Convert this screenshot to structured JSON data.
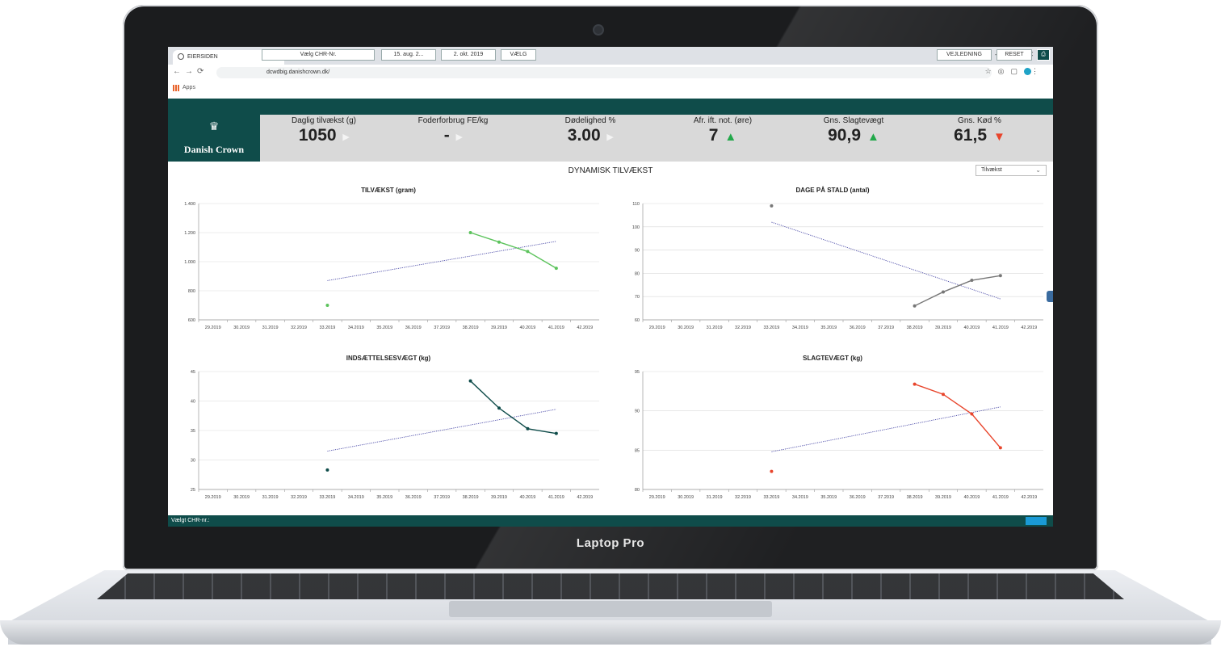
{
  "laptop": {
    "brand": "Laptop Pro"
  },
  "browser": {
    "tab_title": "EIERSIDEN",
    "tab_close": "×",
    "new_tab": "+",
    "url": "dcwdbig.danishcrown.dk/",
    "bookmarks_label": "Apps"
  },
  "app": {
    "logo_text": "Danish Crown",
    "toolbar": {
      "choose_chr": "Vælg CHR-Nr.",
      "date_from": "15. aug. 2...",
      "date_to": "2. okt. 2019",
      "select_button": "VÆLG",
      "guide_button": "VEJLEDNING",
      "reset_button": "RESET"
    },
    "kpis": [
      {
        "label": "Daglig tilvækst (g)",
        "value": "1050",
        "trend": "none"
      },
      {
        "label": "Foderforbrug FE/kg",
        "value": "-",
        "trend": "none"
      },
      {
        "label": "Dødelighed %",
        "value": "3.00",
        "trend": "none"
      },
      {
        "label": "Afr. ift. not. (øre)",
        "value": "7",
        "trend": "up"
      },
      {
        "label": "Gns. Slagtevægt",
        "value": "90,9",
        "trend": "up"
      },
      {
        "label": "Gns. Kød %",
        "value": "61,5",
        "trend": "down"
      }
    ],
    "page_title": "DYNAMISK TILVÆKST",
    "view_dropdown": "Tilvækst",
    "status_text": "Vælgt CHR-nr.:",
    "colors": {
      "brand": "#0f4c4a",
      "up": "#22a84a",
      "down": "#e8452c"
    }
  },
  "chart_data": [
    {
      "type": "line",
      "title": "TILVÆKST (gram)",
      "xlabel": "",
      "ylabel": "",
      "categories": [
        "29.2019",
        "30.2019",
        "31.2019",
        "32.2019",
        "33.2019",
        "34.2019",
        "35.2019",
        "36.2019",
        "37.2019",
        "38.2019",
        "39.2019",
        "40.2019",
        "41.2019",
        "42.2019"
      ],
      "yticks": [
        "1.400",
        "1.200",
        "1.000",
        "800",
        "600"
      ],
      "ylim": [
        600,
        1400
      ],
      "series": [
        {
          "values": [
            null,
            null,
            null,
            null,
            700,
            null,
            null,
            null,
            null,
            1200,
            1135,
            1070,
            955,
            null
          ],
          "color": "#5cc35c"
        }
      ],
      "trend": {
        "from": [
          4,
          870
        ],
        "to": [
          12,
          1140
        ]
      },
      "grid": true
    },
    {
      "type": "line",
      "title": "DAGE PÅ STALD (antal)",
      "xlabel": "",
      "ylabel": "",
      "categories": [
        "29.2019",
        "30.2019",
        "31.2019",
        "32.2019",
        "33.2019",
        "34.2019",
        "35.2019",
        "36.2019",
        "37.2019",
        "38.2019",
        "39.2019",
        "40.2019",
        "41.2019",
        "42.2019"
      ],
      "yticks": [
        "110",
        "100",
        "90",
        "80",
        "70",
        "60"
      ],
      "ylim": [
        60,
        110
      ],
      "series": [
        {
          "values": [
            null,
            null,
            null,
            null,
            109,
            null,
            null,
            null,
            null,
            66,
            72,
            77,
            79,
            null
          ],
          "color": "#777777"
        }
      ],
      "trend": {
        "from": [
          4,
          102
        ],
        "to": [
          12,
          69
        ]
      },
      "grid": true
    },
    {
      "type": "line",
      "title": "INDSÆTTELSESVÆGT (kg)",
      "xlabel": "",
      "ylabel": "",
      "categories": [
        "29.2019",
        "30.2019",
        "31.2019",
        "32.2019",
        "33.2019",
        "34.2019",
        "35.2019",
        "36.2019",
        "37.2019",
        "38.2019",
        "39.2019",
        "40.2019",
        "41.2019",
        "42.2019"
      ],
      "yticks": [
        "45",
        "40",
        "35",
        "30",
        "25"
      ],
      "ylim": [
        25,
        45
      ],
      "series": [
        {
          "values": [
            null,
            null,
            null,
            null,
            28.3,
            null,
            null,
            null,
            null,
            43.4,
            38.8,
            35.3,
            34.5,
            null
          ],
          "color": "#0f4c4a"
        }
      ],
      "trend": {
        "from": [
          4,
          31.5
        ],
        "to": [
          12,
          38.6
        ]
      },
      "grid": true
    },
    {
      "type": "line",
      "title": "SLAGTEVÆGT (kg)",
      "xlabel": "",
      "ylabel": "",
      "categories": [
        "29.2019",
        "30.2019",
        "31.2019",
        "32.2019",
        "33.2019",
        "34.2019",
        "35.2019",
        "36.2019",
        "37.2019",
        "38.2019",
        "39.2019",
        "40.2019",
        "41.2019",
        "42.2019"
      ],
      "yticks": [
        "95",
        "90",
        "85",
        "80"
      ],
      "ylim": [
        80,
        95
      ],
      "series": [
        {
          "values": [
            null,
            null,
            null,
            null,
            82.3,
            null,
            null,
            null,
            null,
            93.4,
            92.1,
            89.6,
            85.3,
            null
          ],
          "color": "#e8452c"
        }
      ],
      "trend": {
        "from": [
          4,
          84.8
        ],
        "to": [
          12,
          90.5
        ]
      },
      "grid": true
    }
  ]
}
